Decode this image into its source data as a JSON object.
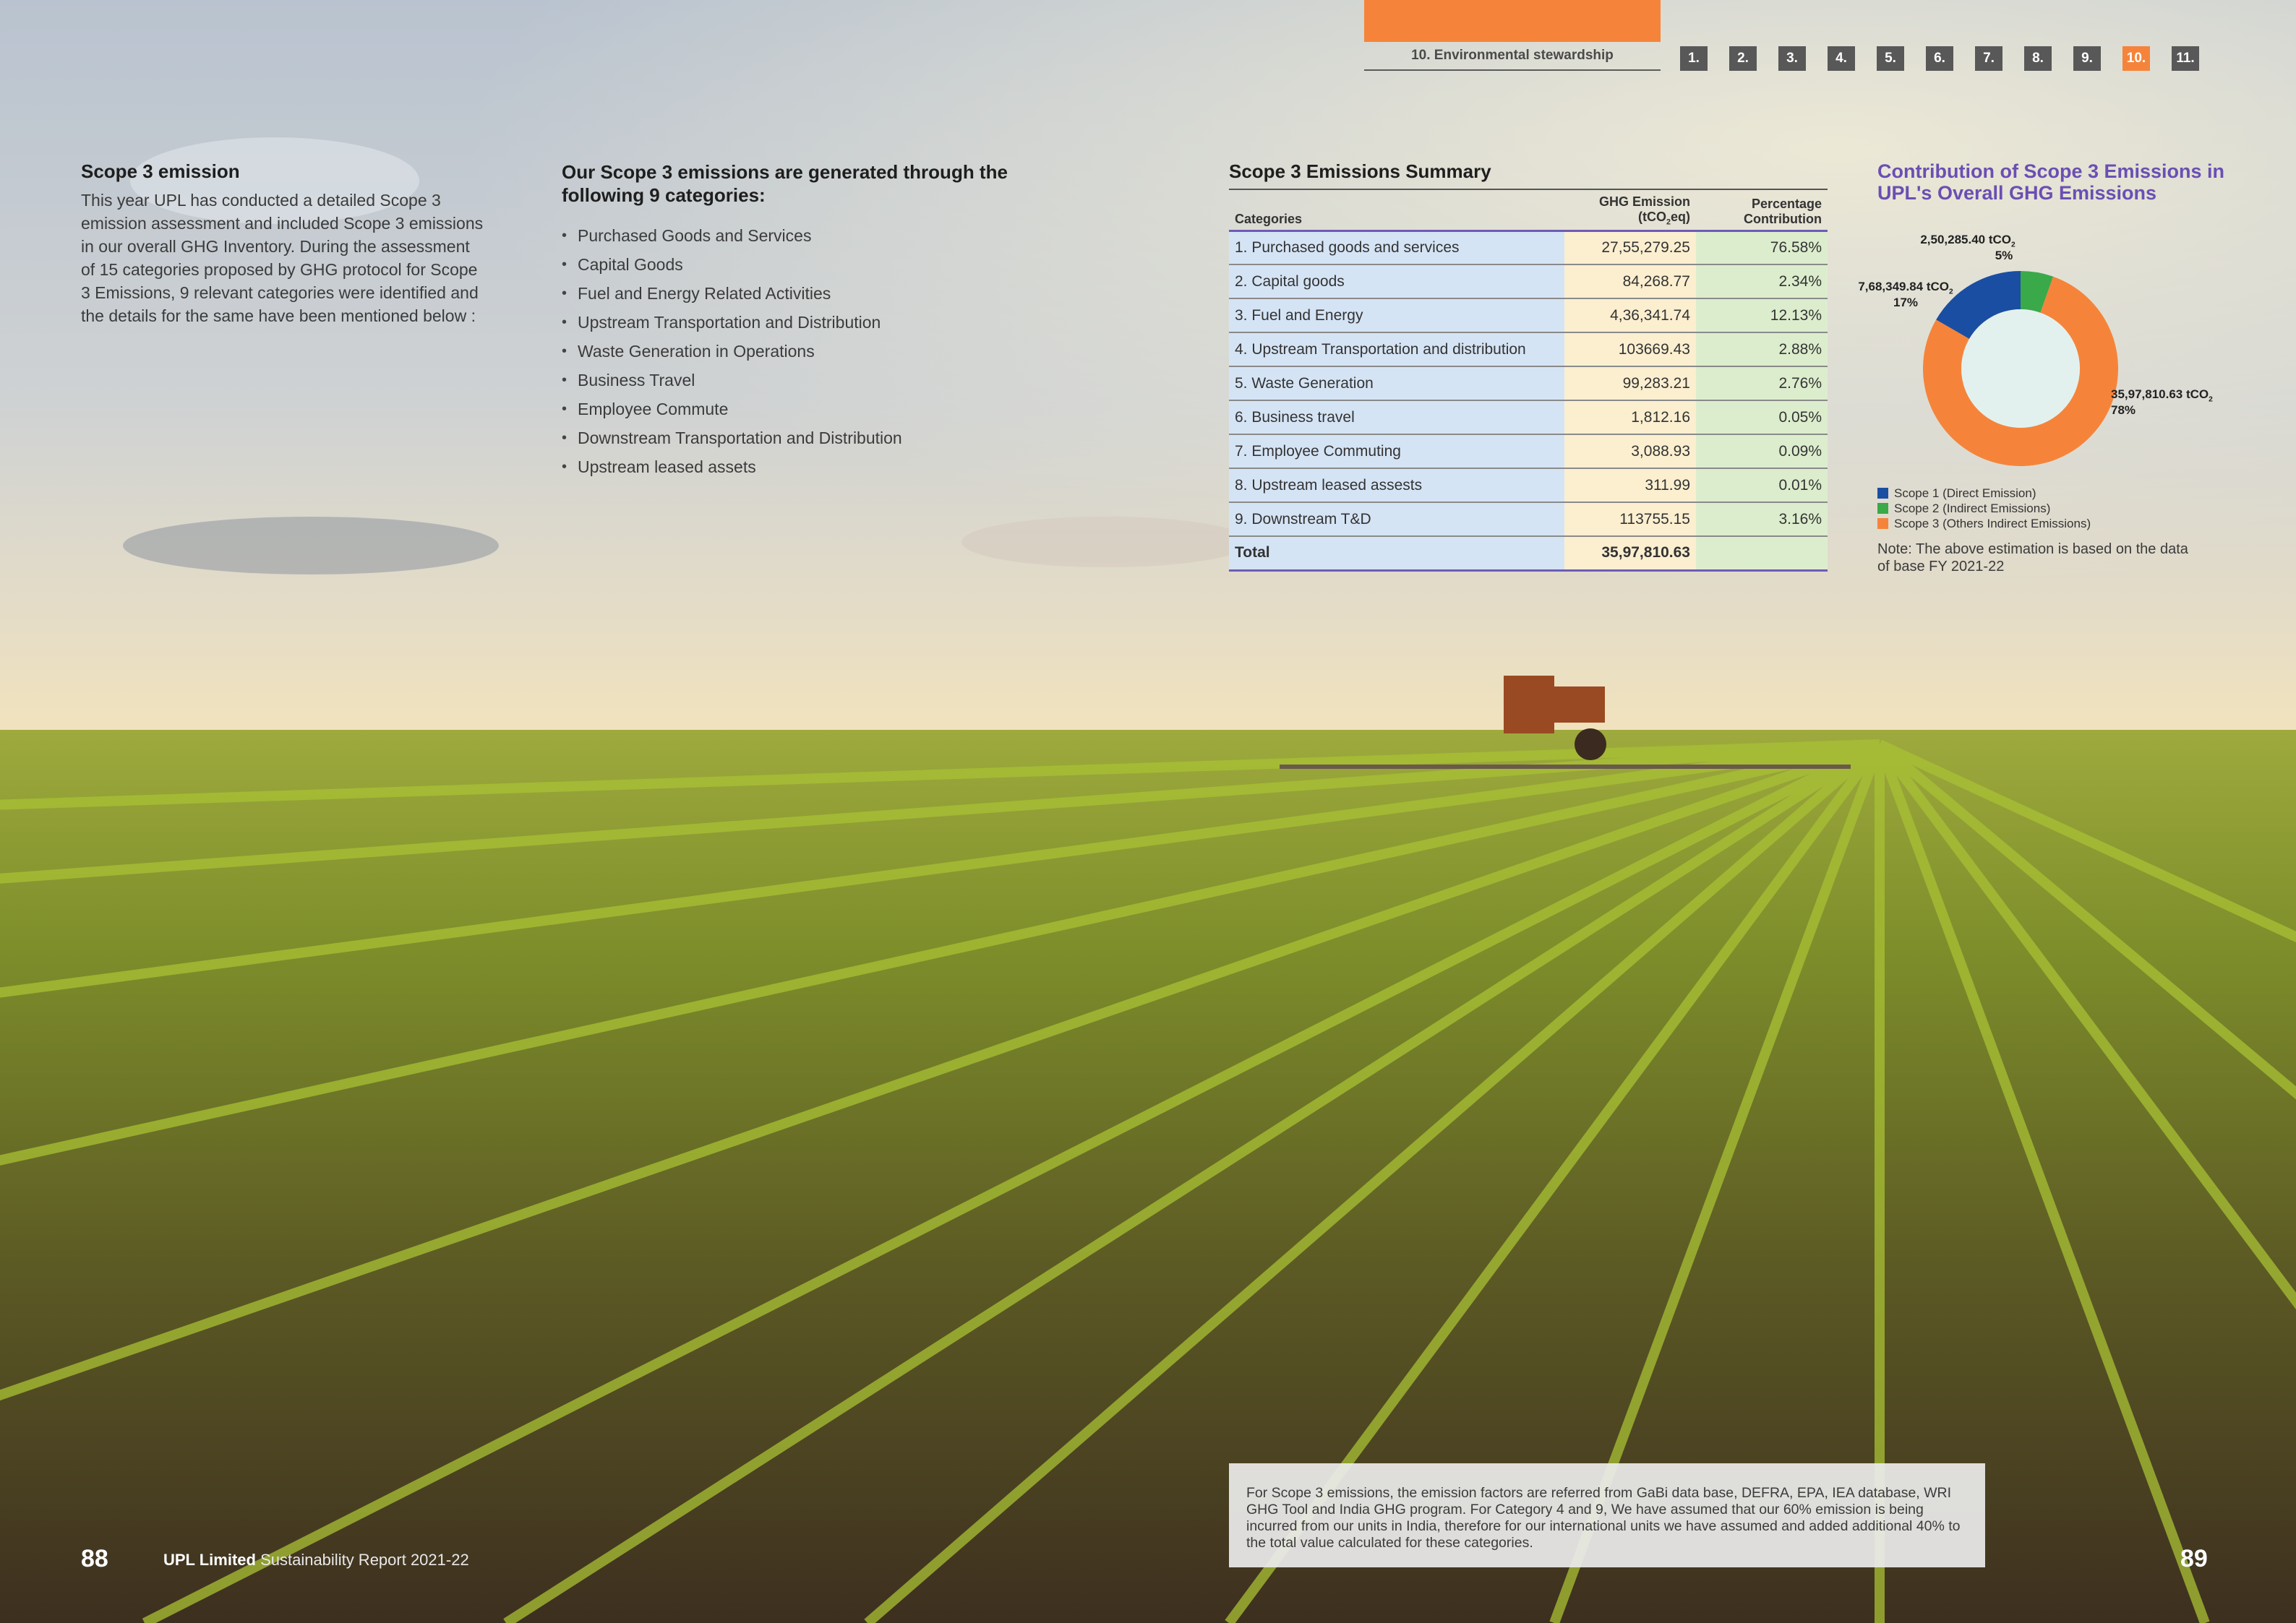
{
  "nav": {
    "section_title": "10. Environmental stewardship",
    "tabs": [
      "1.",
      "2.",
      "3.",
      "4.",
      "5.",
      "6.",
      "7.",
      "8.",
      "9.",
      "10.",
      "11."
    ],
    "active_tab": "10.",
    "accent_color": "#f5843a"
  },
  "intro": {
    "heading": "Scope 3 emission",
    "body": "This year UPL has conducted a detailed Scope 3 emission assessment and included Scope 3 emissions in our overall GHG Inventory. During the assessment of 15 categories proposed by GHG protocol for Scope 3 Emissions, 9 relevant categories were identified and the details for the same have been mentioned below :"
  },
  "categories_list": {
    "heading": "Our Scope 3 emissions are generated through the following 9 categories:",
    "items": [
      "Purchased Goods and Services",
      "Capital Goods",
      "Fuel and Energy Related Activities",
      "Upstream Transportation and Distribution",
      "Waste Generation in Operations",
      "Business Travel",
      "Employee Commute",
      "Downstream Transportation and Distribution",
      "Upstream leased assets"
    ]
  },
  "summary_table": {
    "title": "Scope 3 Emissions Summary",
    "col_categories": "Categories",
    "col_emission_line1": "GHG Emission",
    "col_emission_line2": "(tCO",
    "col_emission_sub": "2",
    "col_emission_line2_end": "eq)",
    "col_pct_line1": "Percentage",
    "col_pct_line2": "Contribution",
    "rows": [
      {
        "category": "1. Purchased goods and services",
        "emission": "27,55,279.25",
        "percent": "76.58%"
      },
      {
        "category": "2. Capital goods",
        "emission": "84,268.77",
        "percent": "2.34%"
      },
      {
        "category": "3. Fuel and Energy",
        "emission": "4,36,341.74",
        "percent": "12.13%"
      },
      {
        "category": "4. Upstream Transportation and distribution",
        "emission": "103669.43",
        "percent": "2.88%"
      },
      {
        "category": "5. Waste Generation",
        "emission": "99,283.21",
        "percent": "2.76%"
      },
      {
        "category": "6. Business travel",
        "emission": "1,812.16",
        "percent": "0.05%"
      },
      {
        "category": "7. Employee Commuting",
        "emission": "3,088.93",
        "percent": "0.09%"
      },
      {
        "category": "8. Upstream leased assests",
        "emission": "311.99",
        "percent": "0.01%"
      },
      {
        "category": "9. Downstream T&D",
        "emission": "113755.15",
        "percent": "3.16%"
      }
    ],
    "total_label": "Total",
    "total_emission": "35,97,810.63",
    "total_percent": ""
  },
  "donut": {
    "title": "Contribution of Scope 3 Emissions in UPL's Overall GHG Emissions",
    "labels": [
      {
        "value": "2,50,285.40 tCO",
        "sub": "2",
        "pct": "5%"
      },
      {
        "value": "7,68,349.84 tCO",
        "sub": "2",
        "pct": "17%"
      },
      {
        "value": "35,97,810.63 tCO",
        "sub": "2",
        "pct": "78%"
      }
    ],
    "legend": [
      "Scope 1 (Direct Emission)",
      "Scope 2 (Indirect Emissions)",
      "Scope 3 (Others Indirect Emissions)"
    ],
    "note": "Note: The above estimation is based on the data of base FY 2021-22"
  },
  "chart_data": {
    "type": "pie",
    "title": "Contribution of Scope 3 Emissions in UPL's Overall GHG Emissions",
    "series": [
      {
        "name": "Scope 1 (Direct Emission)",
        "value": 768349.84,
        "percent": 17,
        "color": "#1a4ea3"
      },
      {
        "name": "Scope 2 (Indirect Emissions)",
        "value": 250285.4,
        "percent": 5,
        "color": "#3aa94a"
      },
      {
        "name": "Scope 3 (Others Indirect Emissions)",
        "value": 3597810.63,
        "percent": 78,
        "color": "#f5843a"
      }
    ]
  },
  "footnote": "For Scope 3 emissions, the emission factors are referred from GaBi data base, DEFRA, EPA, IEA database, WRI GHG Tool and India GHG program. For Category 4 and 9, We have assumed that our 60% emission is being incurred from our units in India, therefore for our international units we have assumed and added additional 40% to the total value calculated for these categories.",
  "footer": {
    "page_left": "88",
    "brand_bold": "UPL Limited",
    "brand_rest": " Sustainability Report 2021-22",
    "page_right": "89"
  }
}
